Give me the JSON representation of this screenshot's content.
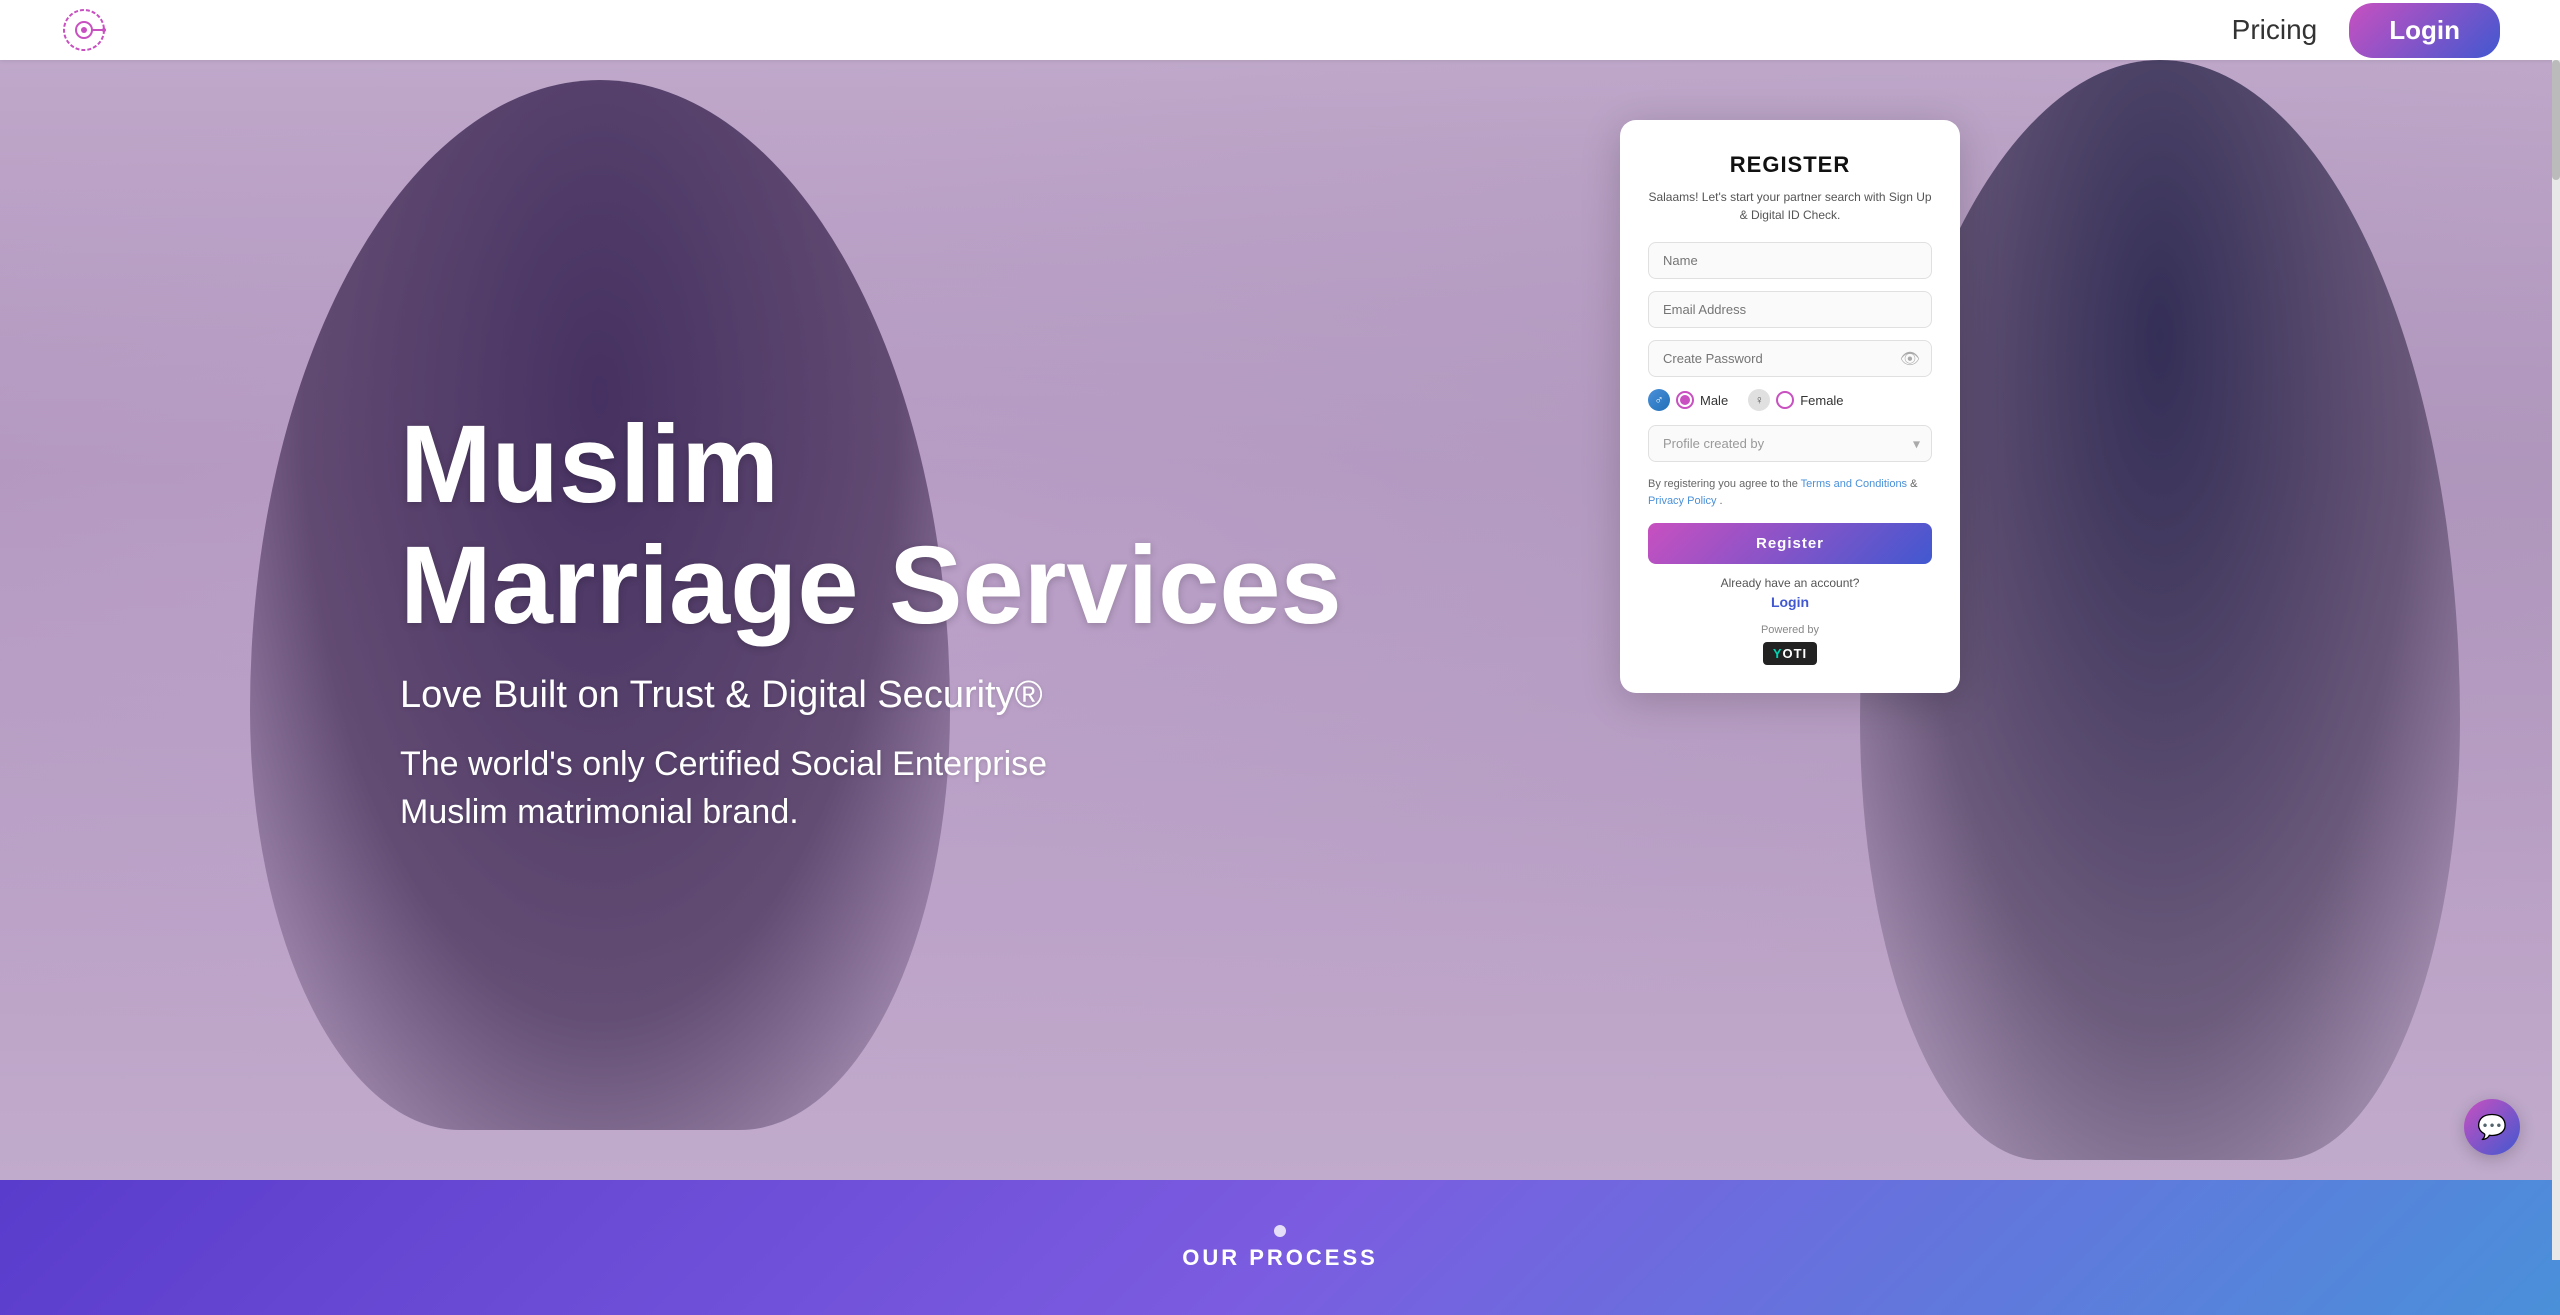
{
  "navbar": {
    "logo_alt": "Muslim Marriage Services Logo",
    "pricing_label": "Pricing",
    "login_label": "Login"
  },
  "hero": {
    "title_line1": "Muslim",
    "title_line2": "Marriage Services",
    "subtitle": "Love Built on Trust & Digital Security®",
    "description": "The world's only Certified Social Enterprise Muslim matrimonial brand."
  },
  "register_card": {
    "title": "REGISTER",
    "subtitle": "Salaams! Let's start your partner search with Sign Up & Digital ID Check.",
    "name_placeholder": "Name",
    "email_placeholder": "Email Address",
    "password_placeholder": "Create Password",
    "gender_male": "Male",
    "gender_female": "Female",
    "profile_created_placeholder": "Profile created by",
    "terms_text": "By registering you agree to the ",
    "terms_conditions": "Terms and Conditions",
    "terms_and": " & ",
    "privacy_policy": "Privacy Policy",
    "terms_end": ".",
    "register_button": "Register",
    "already_account": "Already have an account?",
    "login_link": "Login",
    "powered_by": "Powered by",
    "yoti_text": "YOTI"
  },
  "our_process": {
    "label": "OUR PROCESS"
  },
  "icons": {
    "eye_icon": "👁",
    "chevron_down": "▾",
    "chat_icon": "💬",
    "male_symbol": "♂",
    "female_symbol": "♀"
  }
}
